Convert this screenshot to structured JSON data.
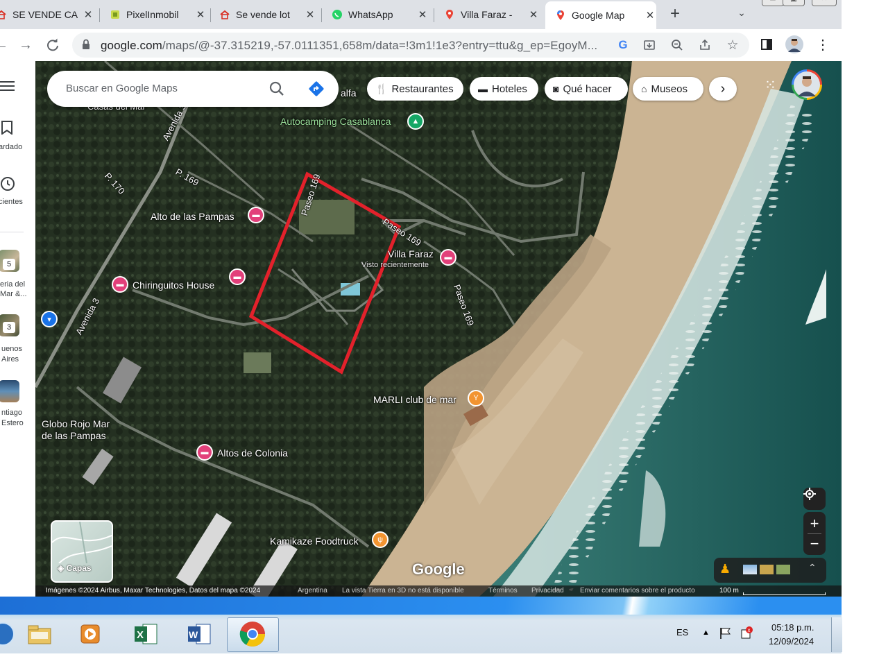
{
  "browser": {
    "tabs": [
      {
        "title": "SE VENDE CA",
        "icon": "house-icon",
        "active": false
      },
      {
        "title": "PixelInmobil",
        "icon": "pixel-icon",
        "active": false
      },
      {
        "title": "Se vende lot",
        "icon": "house-icon",
        "active": false
      },
      {
        "title": "WhatsApp",
        "icon": "whatsapp-icon",
        "active": false
      },
      {
        "title": "Villa Faraz - ",
        "icon": "maps-icon",
        "active": false
      },
      {
        "title": "Google Map",
        "icon": "maps-icon",
        "active": true
      }
    ],
    "new_tab": "+",
    "url_host": "google.com",
    "url_path": "/maps/@-37.315219,-57.0111351,658m/data=!3m1!1e3?entry=ttu&g_ep=EgoyM..."
  },
  "maps": {
    "search_placeholder": "Buscar en Google Maps",
    "chips": [
      {
        "label": "Restaurantes",
        "icon": "fork-knife-icon"
      },
      {
        "label": "Hoteles",
        "icon": "bed-icon"
      },
      {
        "label": "Qué hacer",
        "icon": "camera-icon"
      },
      {
        "label": "Museos",
        "icon": "museum-icon"
      }
    ],
    "rail": {
      "saved_label": "ardado",
      "recent_label": "cientes",
      "recent_items": [
        {
          "badge": "5",
          "line1": "eria del",
          "line2": "Mar &..."
        },
        {
          "badge": "3",
          "line1": "uenos",
          "line2": "Aires"
        },
        {
          "badge": "",
          "line1": "ntiago",
          "line2": "Estero"
        }
      ]
    },
    "labels": {
      "autocamping": "Autocamping Casablanca",
      "alto_pampas": "Alto de las Pampas",
      "chiringuitos": "Chiringuitos House",
      "villa_faraz": "Villa Faraz",
      "villa_faraz_sub": "Visto recientemente",
      "marli": "MARLI club de mar",
      "globo_rojo_1": "Globo Rojo Mar",
      "globo_rojo_2": "de las Pampas",
      "altos_colonia": "Altos de Colonia",
      "kamikaze": "Kamikaze Foodtruck",
      "casas_del_mar": "Casas del Mar",
      "alfa": "alfa",
      "road_avenida3_top": "Avenida 3",
      "road_avenida3_bottom": "Avenida 3",
      "road_p170": "P. 170",
      "road_p169": "P. 169",
      "road_paseo169_a": "Paseo 169",
      "road_paseo169_b": "Paseo 169",
      "road_paseo169_c": "Paseo 169",
      "google_logo": "Google"
    },
    "layers_label": "Capas",
    "footer": {
      "imagery": "Imágenes ©2024 Airbus, Maxar Technologies, Datos del mapa ©2024",
      "country": "Argentina",
      "earth3d": "La vista Tierra en 3D no está disponible",
      "terms": "Términos",
      "privacy": "Privacidad",
      "feedback": "Enviar comentarios sobre el producto",
      "scale": "100 m"
    }
  },
  "taskbar": {
    "language": "ES",
    "time": "05:18 p.m.",
    "date": "12/09/2024"
  },
  "colors": {
    "highlight_rectangle": "#e3212b",
    "hotel_pin": "#e2407a",
    "camping_pin": "#16a766",
    "food_pin": "#f29431",
    "sea": "#1e5b58",
    "sand": "#cbb493"
  }
}
